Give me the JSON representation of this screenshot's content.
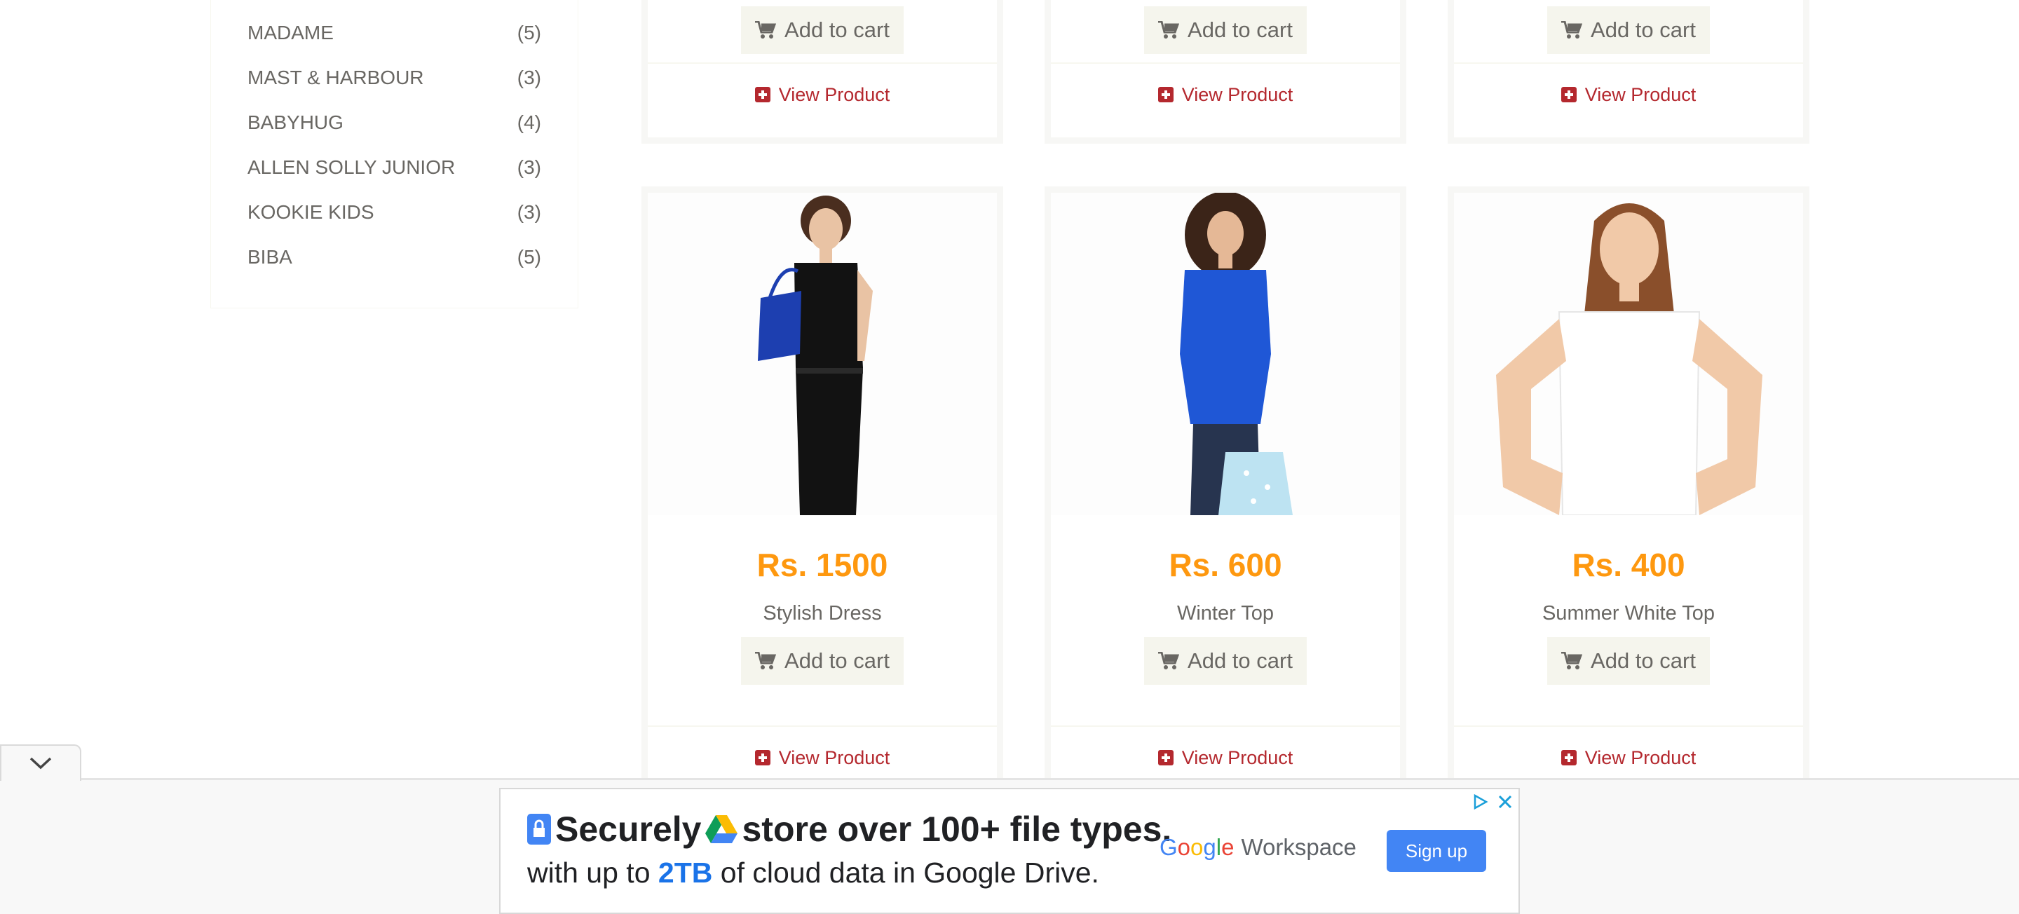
{
  "brands": [
    {
      "name": "MADAME",
      "count": "(5)"
    },
    {
      "name": "MAST & HARBOUR",
      "count": "(3)"
    },
    {
      "name": "BABYHUG",
      "count": "(4)"
    },
    {
      "name": "ALLEN SOLLY JUNIOR",
      "count": "(3)"
    },
    {
      "name": "KOOKIE KIDS",
      "count": "(3)"
    },
    {
      "name": "BIBA",
      "count": "(5)"
    }
  ],
  "top_row": [
    {
      "add_to_cart": "Add to cart",
      "view_product": "View Product"
    },
    {
      "add_to_cart": "Add to cart",
      "view_product": "View Product"
    },
    {
      "add_to_cart": "Add to cart",
      "view_product": "View Product"
    }
  ],
  "products": [
    {
      "price": "Rs. 1500",
      "name": "Stylish Dress",
      "add_to_cart": "Add to cart",
      "view_product": "View Product"
    },
    {
      "price": "Rs. 600",
      "name": "Winter Top",
      "add_to_cart": "Add to cart",
      "view_product": "View Product"
    },
    {
      "price": "Rs. 400",
      "name": "Summer White Top",
      "add_to_cart": "Add to cart",
      "view_product": "View Product"
    }
  ],
  "ad": {
    "headline_1": "Securely",
    "headline_2": "store over 100+ file types.",
    "sub_1": "with up to",
    "sub_highlight": "2TB",
    "sub_2": "of cloud data in Google Drive.",
    "brand_google": "Google",
    "brand_workspace": "Workspace",
    "cta": "Sign up"
  },
  "colors": {
    "price": "#fe980f",
    "link": "#b4282e",
    "ad_button": "#4285f4"
  },
  "icons": [
    "cart-icon",
    "plus-square-icon",
    "chevron-down-icon",
    "lock-icon",
    "drive-icon",
    "adchoices-icon",
    "close-icon"
  ]
}
